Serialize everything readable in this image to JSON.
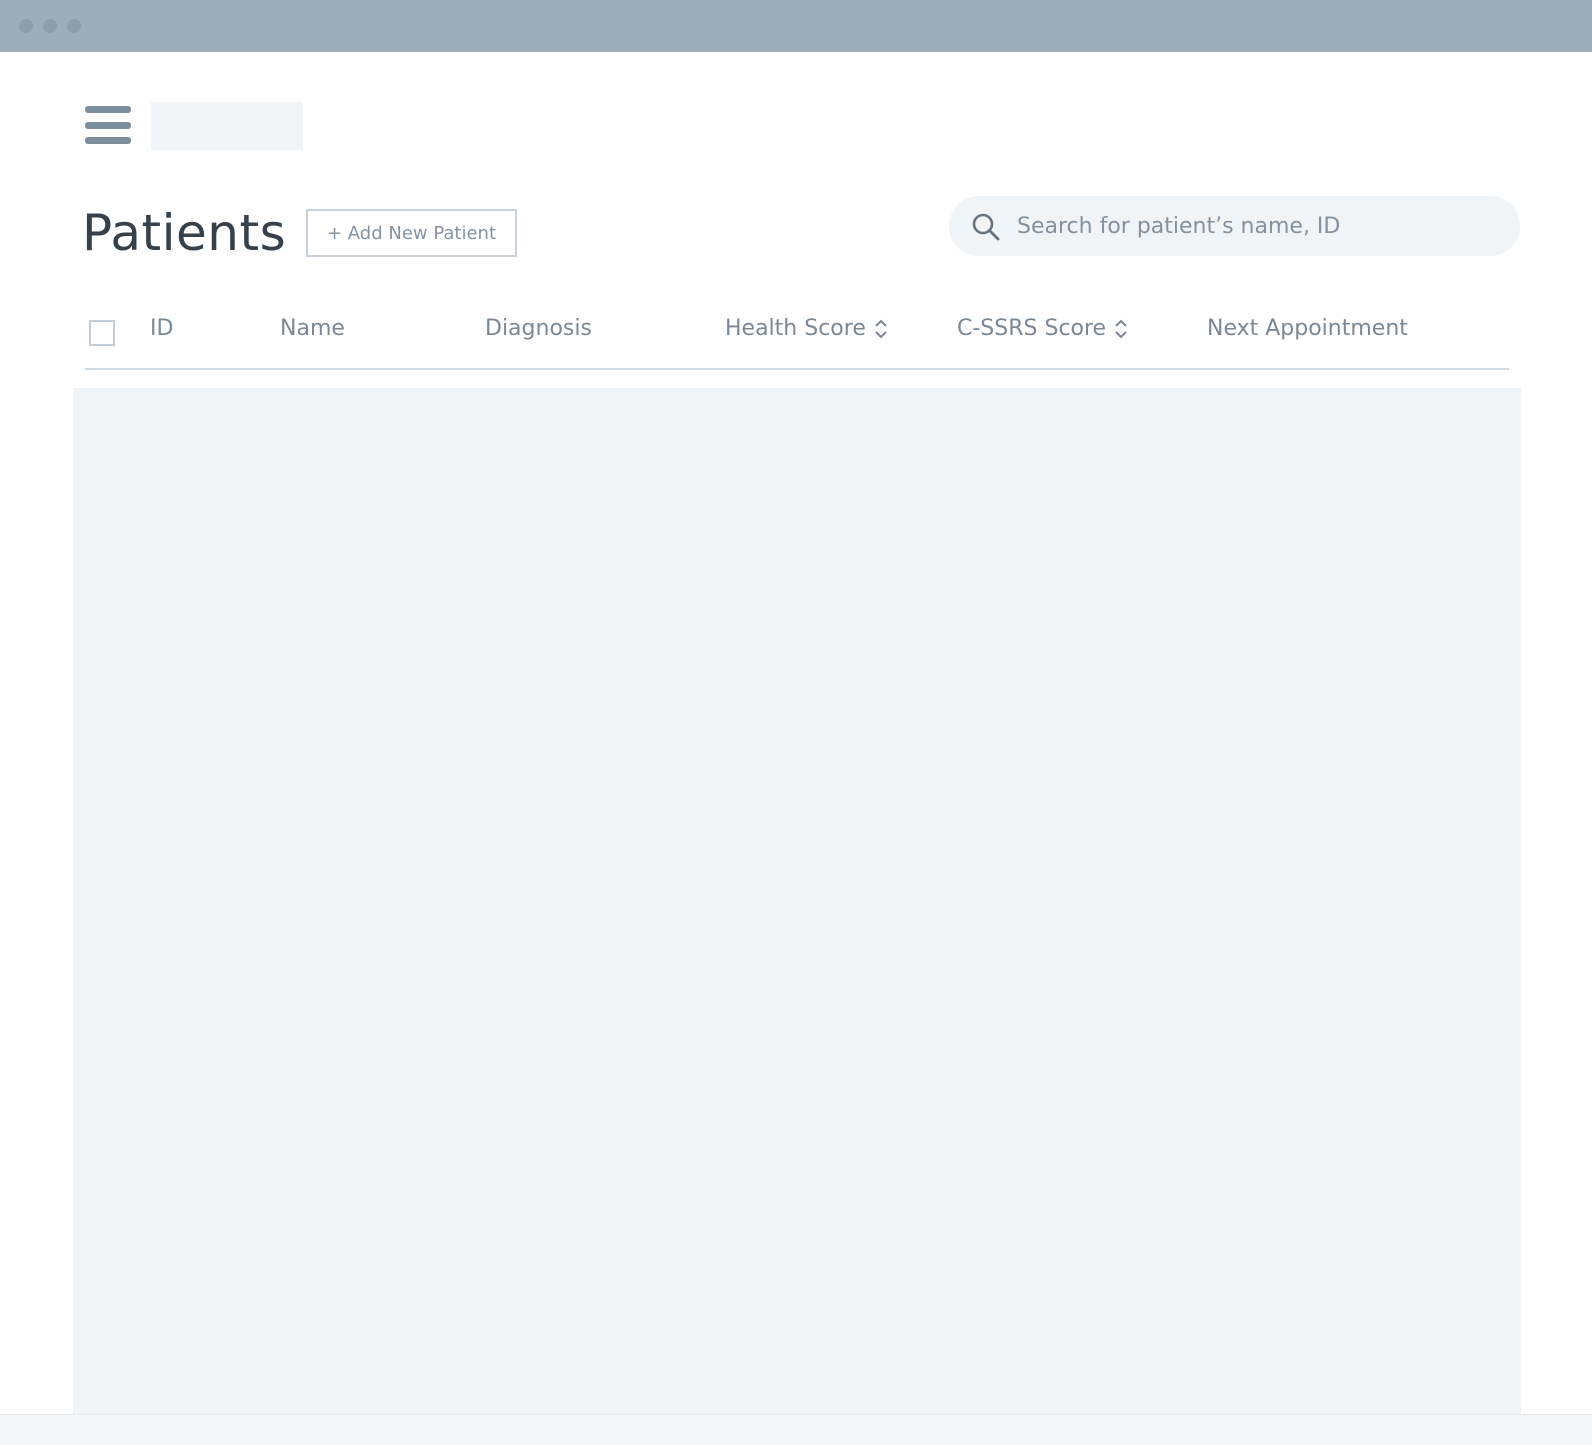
{
  "window": {
    "controls": [
      "close-dot",
      "minimize-dot",
      "maximize-dot"
    ]
  },
  "header": {
    "menu_icon": "hamburger-menu-icon"
  },
  "page": {
    "title": "Patients",
    "add_button_label": "+ Add New Patient"
  },
  "search": {
    "placeholder": "Search for patient’s name, ID",
    "value": "",
    "icon": "search-icon"
  },
  "table": {
    "columns": [
      {
        "label": "ID",
        "sortable": false
      },
      {
        "label": "Name",
        "sortable": false
      },
      {
        "label": "Diagnosis",
        "sortable": false
      },
      {
        "label": "Health Score",
        "sortable": true
      },
      {
        "label": "C-SSRS Score",
        "sortable": true
      },
      {
        "label": "Next Appointment",
        "sortable": false
      }
    ],
    "select_all_checked": false,
    "rows": []
  },
  "colors": {
    "titlebar": "#9eadba",
    "title_text": "#36414c",
    "muted_text": "#7b8996",
    "placeholder_fill": "#f0f4f7"
  }
}
